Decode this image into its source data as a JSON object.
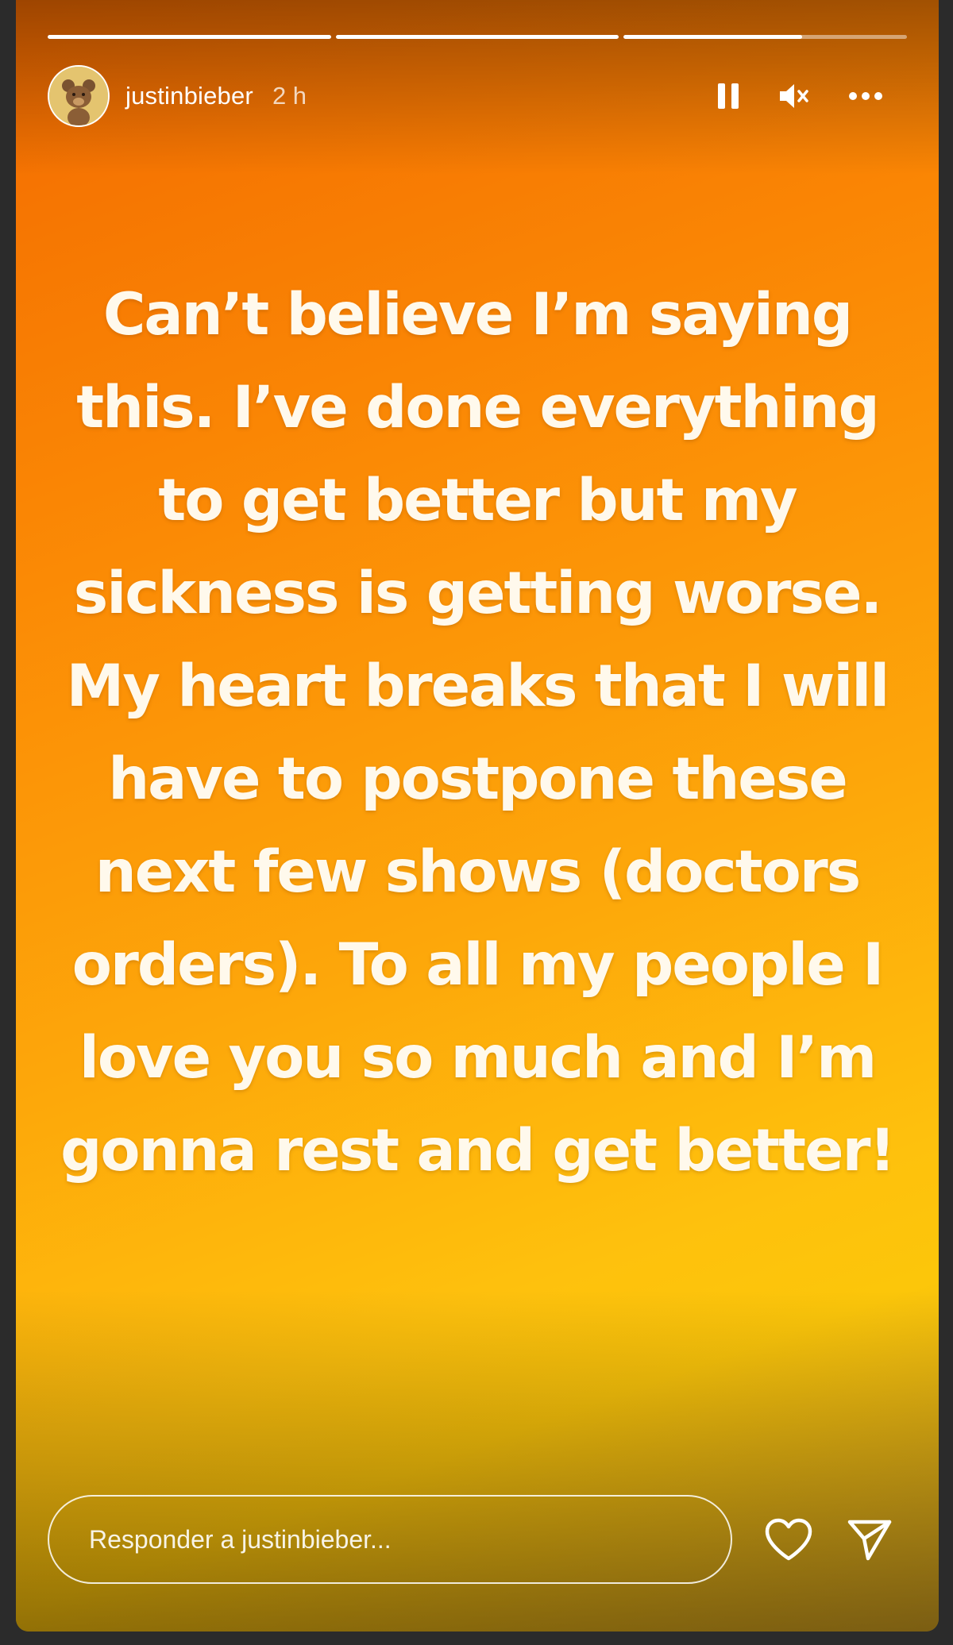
{
  "progress": [
    {
      "fill": 1.0
    },
    {
      "fill": 1.0
    },
    {
      "fill": 0.63
    }
  ],
  "header": {
    "username": "justinbieber",
    "time": "2 h",
    "avatar_icon": "bear-avatar-icon",
    "controls": {
      "pause_icon": "pause-icon",
      "mute_icon": "muted-speaker-icon",
      "more_icon": "more-options-icon"
    }
  },
  "story": {
    "text": "Can’t believe I’m saying this. I’ve done everything to get better but my sickness is getting worse. My heart breaks that I will have to postpone these next few shows (doctors orders). To all my people I love you so much and I’m gonna rest and get better!",
    "gradient_colors": [
      "#f36a00",
      "#fb8a05",
      "#fda60a",
      "#fec10d"
    ]
  },
  "footer": {
    "reply_placeholder": "Responder a justinbieber...",
    "like_icon": "heart-icon",
    "share_icon": "send-icon"
  }
}
